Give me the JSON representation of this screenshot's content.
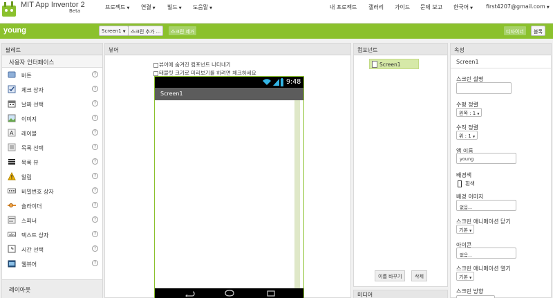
{
  "app": {
    "title": "MIT App Inventor 2",
    "subtitle": "Beta"
  },
  "menu": {
    "left": [
      "프로젝트",
      "연결",
      "빌드",
      "도움말"
    ],
    "right": [
      "내 프로젝트",
      "갤러리",
      "가이드",
      "문제 보고",
      "한국어",
      "first4207@gmail.com"
    ]
  },
  "project": {
    "name": "young",
    "screen_select": "Screen1",
    "add_screen": "스크린 추가 ...",
    "remove_screen": "스크린 제거",
    "designer": "디자이너",
    "blocks": "블록"
  },
  "palette": {
    "title": "팔레트",
    "category": "사용자 인터페이스",
    "items": [
      "버튼",
      "체크 상자",
      "날짜 선택",
      "이미지",
      "레이블",
      "목록 선택",
      "목록 뷰",
      "알림",
      "비밀번호 상자",
      "슬라이더",
      "스피너",
      "텍스트 상자",
      "시간 선택",
      "웹뷰어"
    ],
    "layout_category": "레이아웃",
    "help_glyph": "?"
  },
  "viewer": {
    "title": "뷰어",
    "option1": "뷰어에 숨겨진 컴포넌트 나타내기",
    "option2": "태블릿 크기로 미리보기를 하려면 체크하세요",
    "time": "9:48",
    "screen_title": "Screen1"
  },
  "components": {
    "title": "컴포넌트",
    "tree_item": "Screen1",
    "rename": "이름 바꾸기",
    "delete": "삭제",
    "media": "미디어"
  },
  "properties": {
    "title": "속성",
    "component": "Screen1",
    "screen_desc_label": "스크린 설명",
    "halign_label": "수평 정렬",
    "halign_value": "왼쪽 : 1",
    "valign_label": "수직 정렬",
    "valign_value": "위 : 1",
    "appname_label": "앱 이름",
    "appname_value": "young",
    "bgcolor_label": "배경색",
    "bgcolor_value": "흰색",
    "bgimage_label": "배경 이미지",
    "bgimage_value": "없음...",
    "close_anim_label": "스크린 애니메이션 닫기",
    "close_anim_value": "기본",
    "icon_label": "아이콘",
    "icon_value": "없음...",
    "open_anim_label": "스크린 애니메이션 열기",
    "open_anim_value": "기본",
    "orientation_label": "스크린 방향"
  },
  "colors": {
    "accent": "#8bc12d",
    "header_bg": "#e6e6e6"
  }
}
